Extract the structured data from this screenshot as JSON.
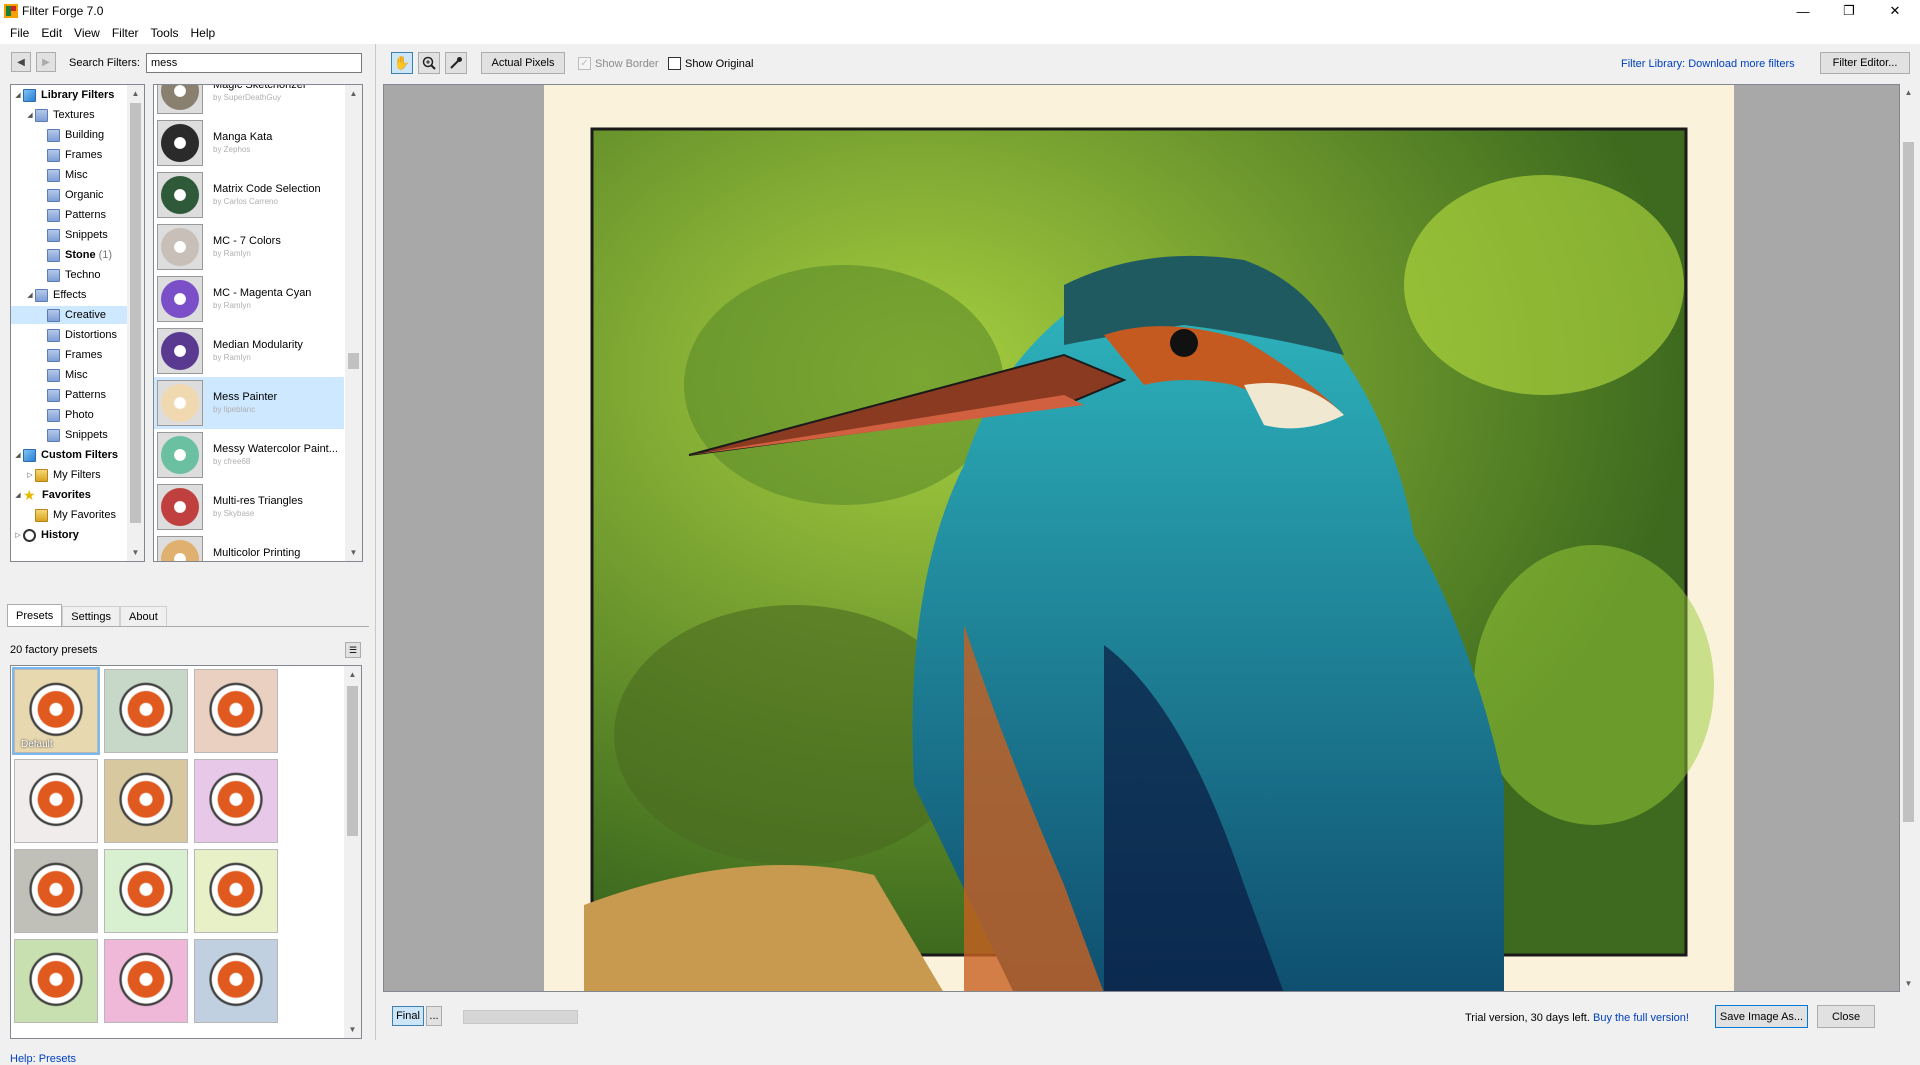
{
  "window": {
    "title": "Filter Forge 7.0",
    "controls": [
      "—",
      "❐",
      "✕"
    ]
  },
  "menu": [
    "File",
    "Edit",
    "View",
    "Filter",
    "Tools",
    "Help"
  ],
  "search": {
    "label": "Search Filters:",
    "value": "mess"
  },
  "tree": [
    {
      "label": "Library Filters",
      "bold": true,
      "icon": "cube-icon",
      "twisty": "expanded",
      "level": 0
    },
    {
      "label": "Textures",
      "icon": "folder-icon",
      "twisty": "expanded",
      "level": 1
    },
    {
      "label": "Building",
      "icon": "folder-icon",
      "level": 2
    },
    {
      "label": "Frames",
      "icon": "folder-icon",
      "level": 2
    },
    {
      "label": "Misc",
      "icon": "folder-icon",
      "level": 2
    },
    {
      "label": "Organic",
      "icon": "folder-icon",
      "level": 2
    },
    {
      "label": "Patterns",
      "icon": "folder-icon",
      "level": 2
    },
    {
      "label": "Snippets",
      "icon": "folder-icon",
      "level": 2
    },
    {
      "label": "Stone",
      "count": "(1)",
      "bold": true,
      "icon": "folder-icon",
      "level": 2
    },
    {
      "label": "Techno",
      "icon": "folder-icon",
      "level": 2
    },
    {
      "label": "Effects",
      "icon": "folder-icon",
      "twisty": "expanded",
      "level": 1
    },
    {
      "label": "Creative",
      "icon": "folder-icon",
      "level": 2,
      "selected": true
    },
    {
      "label": "Distortions",
      "icon": "folder-icon",
      "level": 2
    },
    {
      "label": "Frames",
      "icon": "folder-icon",
      "level": 2
    },
    {
      "label": "Misc",
      "icon": "folder-icon",
      "level": 2
    },
    {
      "label": "Patterns",
      "icon": "folder-icon",
      "level": 2
    },
    {
      "label": "Photo",
      "icon": "folder-icon",
      "level": 2
    },
    {
      "label": "Snippets",
      "icon": "folder-icon",
      "level": 2
    },
    {
      "label": "Custom Filters",
      "bold": true,
      "icon": "cube-icon",
      "twisty": "expanded",
      "level": 0
    },
    {
      "label": "My Filters",
      "icon": "gold-folder-icon",
      "twisty": "collapsed",
      "level": 1
    },
    {
      "label": "Favorites",
      "bold": true,
      "icon": "star-icon",
      "twisty": "expanded",
      "level": 0
    },
    {
      "label": "My Favorites",
      "icon": "gold-folder-icon",
      "level": 1
    },
    {
      "label": "History",
      "bold": true,
      "icon": "clock-icon",
      "twisty": "collapsed",
      "level": 0
    }
  ],
  "filters": [
    {
      "name": "Magic Sketchorizer",
      "author": "by SuperDeathGuy",
      "thumb": "#8a8070"
    },
    {
      "name": "Manga Kata",
      "author": "by Zephos",
      "thumb": "#2a2a2a"
    },
    {
      "name": "Matrix Code Selection",
      "author": "by Carlos Carreno",
      "thumb": "#2f5a3a"
    },
    {
      "name": "MC - 7 Colors",
      "author": "by Ramlyn",
      "thumb": "#c8c0b8"
    },
    {
      "name": "MC - Magenta Cyan",
      "author": "by Ramlyn",
      "thumb": "#7a4fc8"
    },
    {
      "name": "Median Modularity",
      "author": "by Ramlyn",
      "thumb": "#5a3a90"
    },
    {
      "name": "Mess Painter",
      "author": "by lipeblanc",
      "thumb": "#f0d8b0",
      "selected": true
    },
    {
      "name": "Messy Watercolor Paint...",
      "author": "by cfree68",
      "thumb": "#6ac0a0"
    },
    {
      "name": "Multi-res Triangles",
      "author": "by Skybase",
      "thumb": "#c04040"
    },
    {
      "name": "Multicolor Printing",
      "author": "",
      "thumb": "#e0b070"
    }
  ],
  "tabs": [
    "Presets",
    "Settings",
    "About"
  ],
  "presets_count": "20 factory presets",
  "presets": [
    {
      "label": "Default",
      "bg": "#e8d8b0",
      "selected": true
    },
    {
      "label": "",
      "bg": "#c8d8c8"
    },
    {
      "label": "",
      "bg": "#ead0c0"
    },
    {
      "label": "",
      "bg": "#f0ecec"
    },
    {
      "label": "",
      "bg": "#d8c8a0"
    },
    {
      "label": "",
      "bg": "#e8c8e8"
    },
    {
      "label": "",
      "bg": "#c0c0b8"
    },
    {
      "label": "",
      "bg": "#d8f0d0"
    },
    {
      "label": "",
      "bg": "#e8f0c8"
    },
    {
      "label": "",
      "bg": "#c8e0b0"
    },
    {
      "label": "",
      "bg": "#f0b8d8"
    },
    {
      "label": "",
      "bg": "#c0d0e0"
    }
  ],
  "help": {
    "label": "Help: Presets"
  },
  "toolbar": {
    "tools": [
      "hand-icon",
      "zoom-icon",
      "eyedropper-icon"
    ],
    "actual_pixels": "Actual Pixels",
    "show_border": "Show Border",
    "show_original": "Show Original",
    "library_link": "Filter Library: Download more filters",
    "filter_editor": "Filter Editor..."
  },
  "status": {
    "final": "Final",
    "more": "...",
    "trial_text": "Trial version, 30 days left.",
    "buy_link": "Buy the full version!",
    "save": "Save Image As...",
    "close": "Close"
  },
  "colors": {
    "link": "#0040c0",
    "selection": "#cde8ff",
    "canvas_bg": "#a8a8a8"
  }
}
